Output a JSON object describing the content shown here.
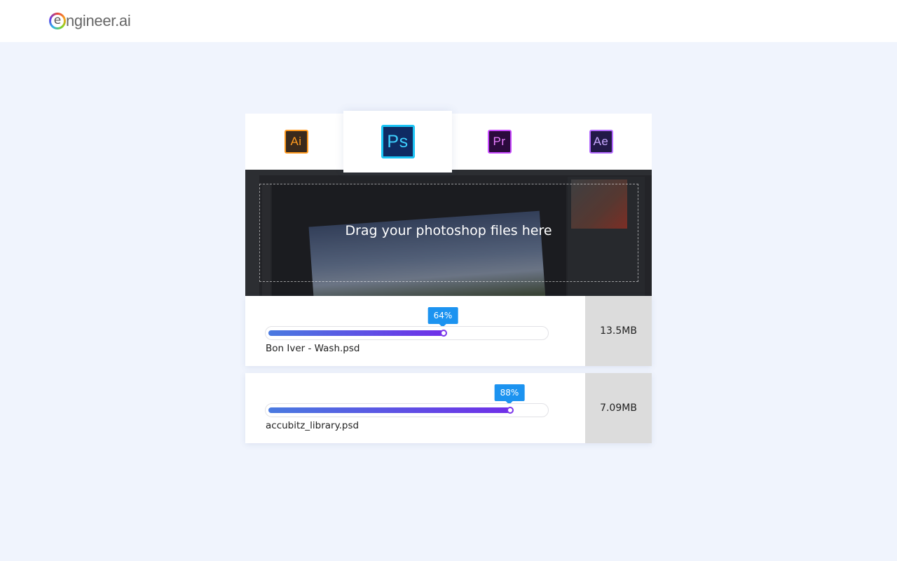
{
  "header": {
    "logo_letter": "e",
    "logo_text": "ngineer.ai"
  },
  "tabs": [
    {
      "label": "Ai",
      "icon": "illustrator-icon",
      "bg": "#3a2a1c",
      "fg": "#ff9a1f",
      "border": "#ff9a1f",
      "active": false
    },
    {
      "label": "Ps",
      "icon": "photoshop-icon",
      "bg": "#0f2b63",
      "fg": "#3ed0ff",
      "border": "#1cc4f5",
      "active": true
    },
    {
      "label": "Pr",
      "icon": "premiere-icon",
      "bg": "#2b0a3d",
      "fg": "#e87fff",
      "border": "#c94bff",
      "active": false
    },
    {
      "label": "Ae",
      "icon": "after-effects-icon",
      "bg": "#221948",
      "fg": "#c8a8ff",
      "border": "#b56bff",
      "active": false
    }
  ],
  "dropzone": {
    "text": "Drag your photoshop files here"
  },
  "files": [
    {
      "name": "Bon Iver - Wash.psd",
      "progress_label": "64%",
      "progress": 0.64,
      "size": "13.5MB"
    },
    {
      "name": "accubitz_library.psd",
      "progress_label": "88%",
      "progress": 0.88,
      "size": "7.09MB"
    }
  ],
  "colors": {
    "accent": "#1c93f0",
    "progress_start": "#4a7ae0",
    "progress_end": "#6f2fe8",
    "background": "#f0f4fd"
  }
}
